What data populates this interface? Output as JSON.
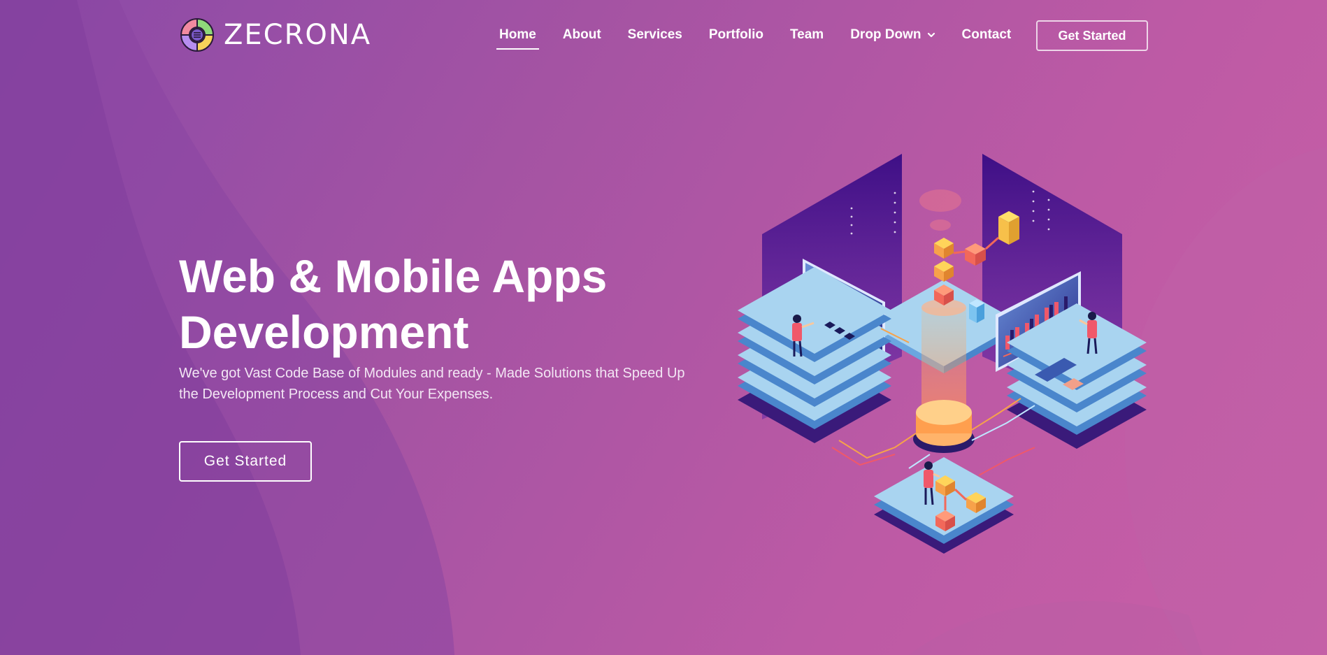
{
  "brand": {
    "name": "ZECRONA",
    "logo_icon": "circular-segments-logo-icon"
  },
  "nav": {
    "items": [
      {
        "label": "Home",
        "active": true
      },
      {
        "label": "About"
      },
      {
        "label": "Services"
      },
      {
        "label": "Portfolio"
      },
      {
        "label": "Team"
      },
      {
        "label": "Drop Down",
        "icon": "chevron-down-icon"
      },
      {
        "label": "Contact"
      }
    ],
    "cta_label": "Get Started"
  },
  "hero": {
    "title_line1": "Web & Mobile Apps",
    "title_line2": "Development",
    "subtitle": "We've got Vast Code Base of Modules and ready - Made Solutions that Speed Up the Development Process and Cut Your Expenses.",
    "cta_label": "Get Started"
  },
  "illustration": {
    "icon": "isometric-data-platform-illustration"
  },
  "colors": {
    "background_start": "#8b4aa8",
    "background_end": "#c95fa6",
    "text": "#ffffff",
    "platform": "#a9d4f0",
    "accent_orange": "#f7a24a",
    "accent_red": "#f0586a",
    "panel_purple": "#4a1a8c"
  }
}
